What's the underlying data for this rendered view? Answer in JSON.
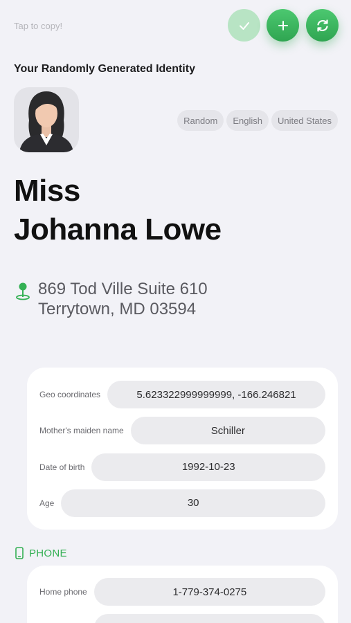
{
  "header": {
    "hint": "Tap to copy!",
    "colors": {
      "accent": "#34b054",
      "accent_disabled": "#b8e4c4"
    },
    "buttons": [
      {
        "icon": "checkmark-icon",
        "state": "disabled"
      },
      {
        "icon": "plus-icon"
      },
      {
        "icon": "refresh-icon"
      }
    ]
  },
  "identity": {
    "section_title": "Your Randomly Generated Identity",
    "avatar_icon": "woman-avatar-icon",
    "chips": [
      "Random",
      "English",
      "United States"
    ],
    "title": "Miss",
    "full_name": "Johanna Lowe",
    "address_line1": "869 Tod Ville Suite 610",
    "address_line2": "Terrytown, MD 03594"
  },
  "details": [
    {
      "label": "Geo coordinates",
      "value": "5.623322999999999, -166.246821"
    },
    {
      "label": "Mother's maiden name",
      "value": "Schiller"
    },
    {
      "label": "Date of birth",
      "value": "1992-10-23"
    },
    {
      "label": "Age",
      "value": "30"
    }
  ],
  "phone": {
    "section_label": "PHONE",
    "rows": [
      {
        "label": "Home phone",
        "value": "1-779-374-0275"
      }
    ]
  }
}
